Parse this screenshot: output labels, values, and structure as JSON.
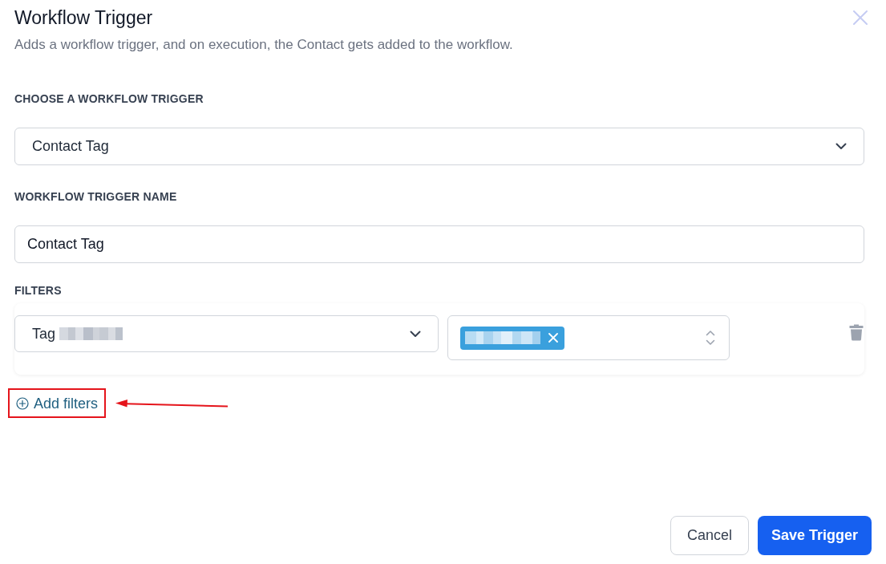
{
  "dialog": {
    "title": "Workflow Trigger",
    "description": "Adds a workflow trigger, and on execution, the Contact gets added to the workflow."
  },
  "fields": [
    {
      "kind": "select",
      "label": "CHOOSE A WORKFLOW TRIGGER",
      "value": "Contact Tag"
    },
    {
      "kind": "text",
      "label": "WORKFLOW TRIGGER NAME",
      "value": "Contact Tag"
    }
  ],
  "filters": {
    "label": "FILTERS",
    "rows": [
      {
        "field": {
          "value": "Tag",
          "redacted": true
        },
        "tags": [
          {
            "redacted": true
          }
        ]
      }
    ]
  },
  "add_filters": {
    "label": "Add filters",
    "highlighted": true,
    "arrow": true
  },
  "buttons": [
    {
      "label": "Cancel",
      "kind": "secondary"
    },
    {
      "label": "Save Trigger",
      "kind": "primary"
    }
  ]
}
